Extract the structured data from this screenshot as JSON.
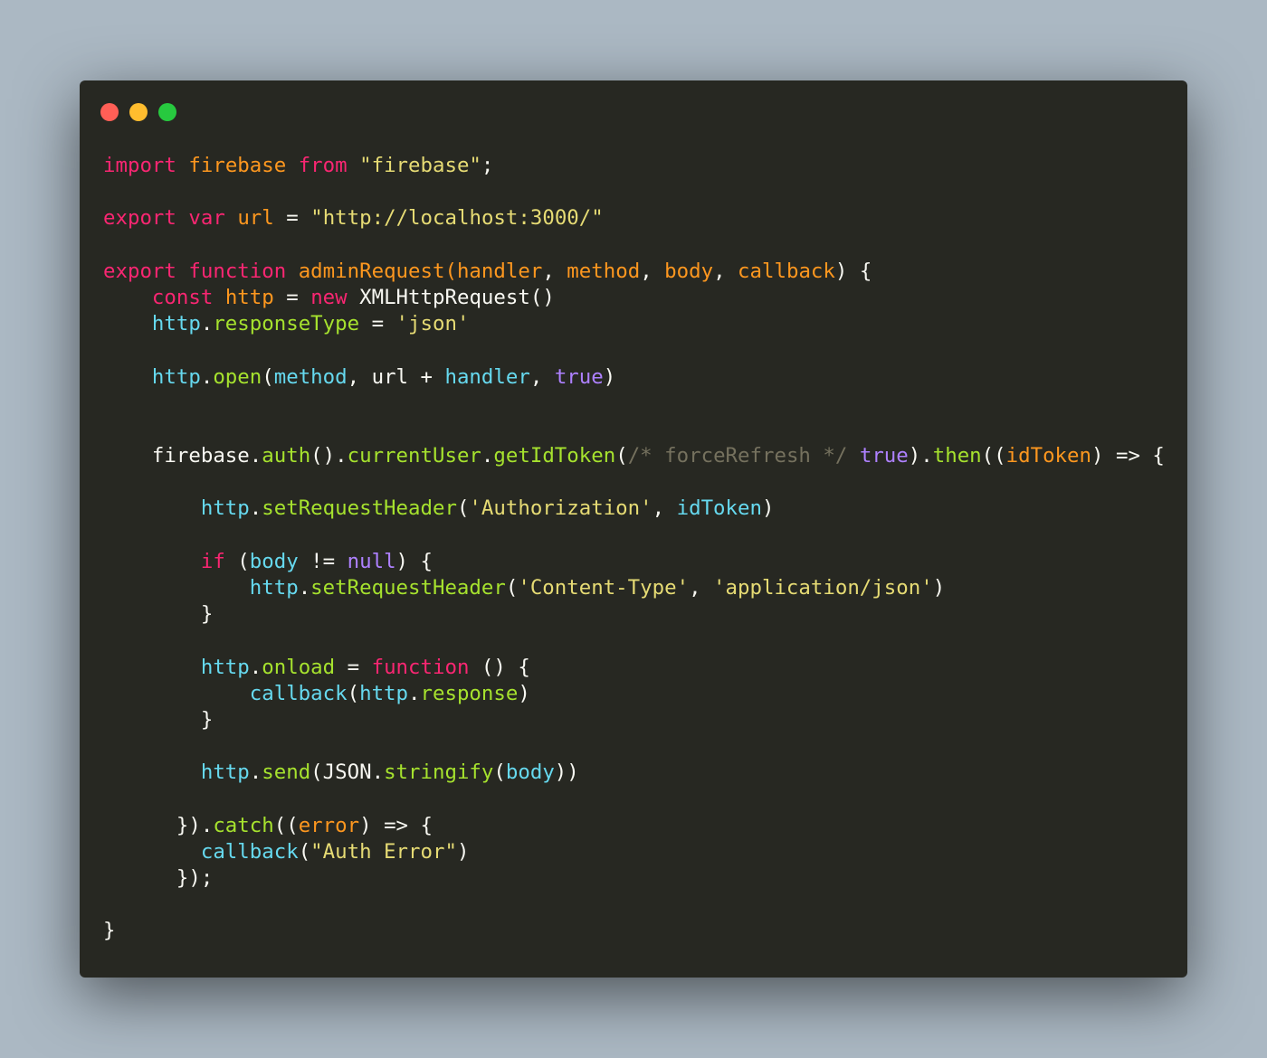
{
  "window": {
    "controls": [
      {
        "name": "close",
        "color": "#ff5f56"
      },
      {
        "name": "minimize",
        "color": "#ffbd2e"
      },
      {
        "name": "maximize",
        "color": "#27c93f"
      }
    ]
  },
  "code_lines": [
    [
      [
        "kw",
        "import"
      ],
      [
        "pl",
        " "
      ],
      [
        "var",
        "firebase"
      ],
      [
        "pl",
        " "
      ],
      [
        "kw",
        "from"
      ],
      [
        "pl",
        " "
      ],
      [
        "str",
        "\"firebase\""
      ],
      [
        "pl",
        ";"
      ]
    ],
    [],
    [
      [
        "kw",
        "export"
      ],
      [
        "pl",
        " "
      ],
      [
        "kw",
        "var"
      ],
      [
        "pl",
        " "
      ],
      [
        "var",
        "url"
      ],
      [
        "pl",
        " = "
      ],
      [
        "str",
        "\"http://localhost:3000/\""
      ]
    ],
    [],
    [
      [
        "kw",
        "export"
      ],
      [
        "pl",
        " "
      ],
      [
        "kw",
        "function"
      ],
      [
        "pl",
        " "
      ],
      [
        "var",
        "adminRequest("
      ],
      [
        "var",
        "handler"
      ],
      [
        "pl",
        ", "
      ],
      [
        "var",
        "method"
      ],
      [
        "pl",
        ", "
      ],
      [
        "var",
        "body"
      ],
      [
        "pl",
        ", "
      ],
      [
        "var",
        "callback"
      ],
      [
        "pl",
        ") {"
      ]
    ],
    [
      [
        "pl",
        "    "
      ],
      [
        "kw",
        "const"
      ],
      [
        "pl",
        " "
      ],
      [
        "var",
        "http"
      ],
      [
        "pl",
        " = "
      ],
      [
        "kw",
        "new"
      ],
      [
        "pl",
        " XMLHttpRequest()"
      ]
    ],
    [
      [
        "pl",
        "    "
      ],
      [
        "obj",
        "http"
      ],
      [
        "pl",
        "."
      ],
      [
        "fn",
        "responseType"
      ],
      [
        "pl",
        " = "
      ],
      [
        "str",
        "'json'"
      ]
    ],
    [],
    [
      [
        "pl",
        "    "
      ],
      [
        "obj",
        "http"
      ],
      [
        "pl",
        "."
      ],
      [
        "fn",
        "open"
      ],
      [
        "pl",
        "("
      ],
      [
        "obj",
        "method"
      ],
      [
        "pl",
        ", url + "
      ],
      [
        "obj",
        "handler"
      ],
      [
        "pl",
        ", "
      ],
      [
        "bool",
        "true"
      ],
      [
        "pl",
        ")"
      ]
    ],
    [],
    [],
    [
      [
        "pl",
        "    firebase."
      ],
      [
        "fn",
        "auth"
      ],
      [
        "pl",
        "()."
      ],
      [
        "fn",
        "currentUser"
      ],
      [
        "pl",
        "."
      ],
      [
        "fn",
        "getIdToken"
      ],
      [
        "pl",
        "("
      ],
      [
        "cm",
        "/* forceRefresh */"
      ],
      [
        "pl",
        " "
      ],
      [
        "bool",
        "true"
      ],
      [
        "pl",
        ")."
      ],
      [
        "fn",
        "then"
      ],
      [
        "pl",
        "(("
      ],
      [
        "var",
        "idToken"
      ],
      [
        "pl",
        ") => {"
      ]
    ],
    [],
    [
      [
        "pl",
        "        "
      ],
      [
        "obj",
        "http"
      ],
      [
        "pl",
        "."
      ],
      [
        "fn",
        "setRequestHeader"
      ],
      [
        "pl",
        "("
      ],
      [
        "str",
        "'Authorization'"
      ],
      [
        "pl",
        ", "
      ],
      [
        "obj",
        "idToken"
      ],
      [
        "pl",
        ")"
      ]
    ],
    [],
    [
      [
        "pl",
        "        "
      ],
      [
        "kw",
        "if"
      ],
      [
        "pl",
        " ("
      ],
      [
        "obj",
        "body"
      ],
      [
        "pl",
        " != "
      ],
      [
        "bool",
        "null"
      ],
      [
        "pl",
        ") {"
      ]
    ],
    [
      [
        "pl",
        "            "
      ],
      [
        "obj",
        "http"
      ],
      [
        "pl",
        "."
      ],
      [
        "fn",
        "setRequestHeader"
      ],
      [
        "pl",
        "("
      ],
      [
        "str",
        "'Content-Type'"
      ],
      [
        "pl",
        ", "
      ],
      [
        "str",
        "'application/json'"
      ],
      [
        "pl",
        ")"
      ]
    ],
    [
      [
        "pl",
        "        }"
      ]
    ],
    [],
    [
      [
        "pl",
        "        "
      ],
      [
        "obj",
        "http"
      ],
      [
        "pl",
        "."
      ],
      [
        "fn",
        "onload"
      ],
      [
        "pl",
        " = "
      ],
      [
        "kw",
        "function"
      ],
      [
        "pl",
        " () {"
      ]
    ],
    [
      [
        "pl",
        "            "
      ],
      [
        "obj",
        "callback"
      ],
      [
        "pl",
        "("
      ],
      [
        "obj",
        "http"
      ],
      [
        "pl",
        "."
      ],
      [
        "fn",
        "response"
      ],
      [
        "pl",
        ")"
      ]
    ],
    [
      [
        "pl",
        "        }"
      ]
    ],
    [],
    [
      [
        "pl",
        "        "
      ],
      [
        "obj",
        "http"
      ],
      [
        "pl",
        "."
      ],
      [
        "fn",
        "send"
      ],
      [
        "pl",
        "(JSON."
      ],
      [
        "fn",
        "stringify"
      ],
      [
        "pl",
        "("
      ],
      [
        "obj",
        "body"
      ],
      [
        "pl",
        "))"
      ]
    ],
    [],
    [
      [
        "pl",
        "      })."
      ],
      [
        "fn",
        "catch"
      ],
      [
        "pl",
        "(("
      ],
      [
        "var",
        "error"
      ],
      [
        "pl",
        ") => {"
      ]
    ],
    [
      [
        "pl",
        "        "
      ],
      [
        "obj",
        "callback"
      ],
      [
        "pl",
        "("
      ],
      [
        "str",
        "\"Auth Error\""
      ],
      [
        "pl",
        ")"
      ]
    ],
    [
      [
        "pl",
        "      });"
      ]
    ],
    [],
    [
      [
        "pl",
        "}"
      ]
    ]
  ]
}
